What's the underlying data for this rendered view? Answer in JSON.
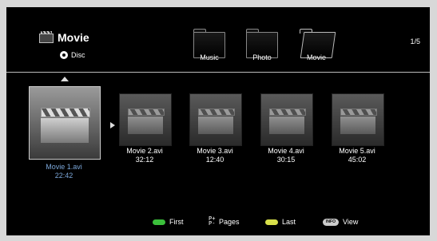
{
  "header": {
    "title": "Movie",
    "source_label": "Disc",
    "page_count": "1/5",
    "folders": [
      {
        "label": "Music",
        "icon": "folder-icon",
        "active": false
      },
      {
        "label": "Photo",
        "icon": "folder-icon",
        "active": false
      },
      {
        "label": "Movie",
        "icon": "folder-open-icon",
        "active": true
      }
    ]
  },
  "items": [
    {
      "name": "Movie 1.avi",
      "duration": "22:42",
      "selected": true,
      "icon": "clapperboard-icon"
    },
    {
      "name": "Movie 2.avi",
      "duration": "32:12",
      "selected": false,
      "icon": "clapperboard-icon"
    },
    {
      "name": "Movie 3.avi",
      "duration": "12:40",
      "selected": false,
      "icon": "clapperboard-icon"
    },
    {
      "name": "Movie 4.avi",
      "duration": "30:15",
      "selected": false,
      "icon": "clapperboard-icon"
    },
    {
      "name": "Movie 5.avi",
      "duration": "45:02",
      "selected": false,
      "icon": "clapperboard-icon"
    }
  ],
  "footer": {
    "first_label": "First",
    "pages_label": "Pages",
    "last_label": "Last",
    "view_label": "View",
    "info_key_label": "INFO",
    "first_color": "#3bbf3b",
    "last_color": "#d8e04a",
    "info_color": "#cccccc"
  },
  "colors": {
    "background": "#000000",
    "selected_text": "#7aa6d8",
    "divider": "#bbbbbb"
  }
}
